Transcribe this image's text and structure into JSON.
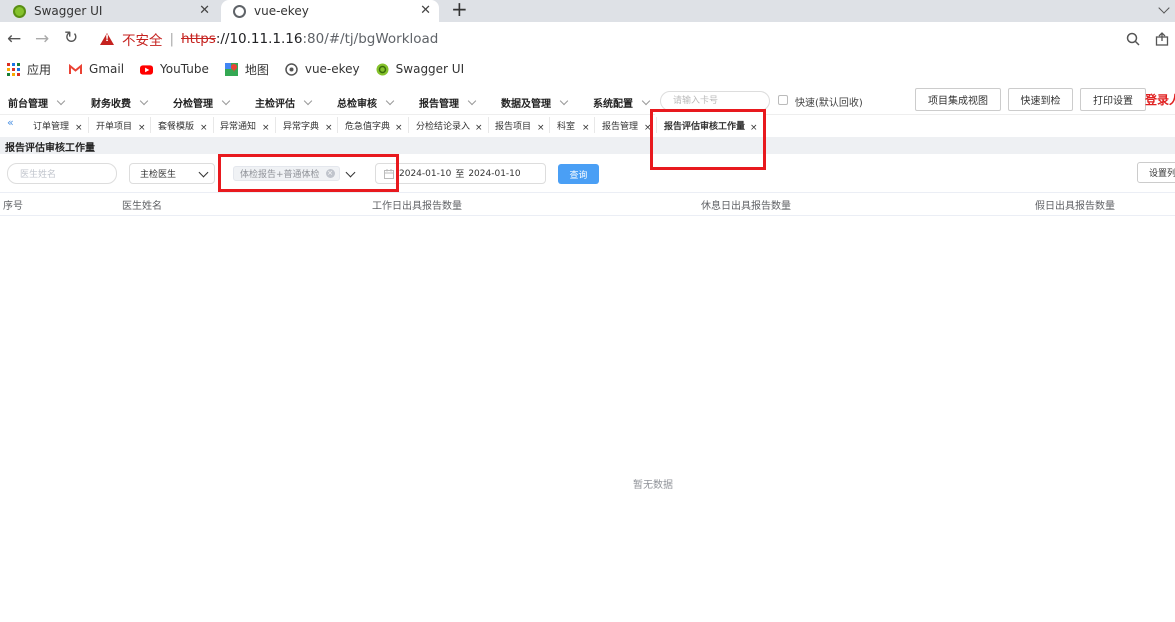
{
  "browser": {
    "tabs": [
      {
        "title": "Swagger UI",
        "close": "✕"
      },
      {
        "title": "vue-ekey",
        "close": "✕"
      }
    ],
    "new_tab": "+",
    "security_label": "不安全",
    "separator": "|",
    "url_protocol": "https",
    "url_host": "://10.11.1.16",
    "url_path": ":80/#/tj/bgWorkload",
    "bookmarks": [
      {
        "label": "应用",
        "icon": "apps-grid-icon"
      },
      {
        "label": "Gmail",
        "icon": "gmail-icon"
      },
      {
        "label": "YouTube",
        "icon": "youtube-icon"
      },
      {
        "label": "地图",
        "icon": "maps-icon"
      },
      {
        "label": "vue-ekey",
        "icon": "globe-icon"
      },
      {
        "label": "Swagger UI",
        "icon": "swagger-icon"
      }
    ]
  },
  "app": {
    "menus": [
      "前台管理",
      "财务收费",
      "分检管理",
      "主检评估",
      "总检审核",
      "报告管理",
      "数据及管理",
      "系统配置"
    ],
    "card_placeholder": "请输入卡号",
    "fast_check_label": "快速(默认回收)",
    "buttons": {
      "project_view": "项目集成视图",
      "quick_checkin": "快速到检",
      "print_settings": "打印设置"
    },
    "login_label": "登录人",
    "collapse_icon": "«",
    "page_tabs": [
      "订单管理",
      "开单项目",
      "套餐模版",
      "异常通知",
      "异常字典",
      "危急值字典",
      "分检结论录入",
      "报告项目",
      "科室",
      "报告管理",
      "报告评估审核工作量"
    ],
    "tab_close": "×",
    "page_title": "报告评估审核工作量"
  },
  "filters": {
    "doctor_name_placeholder": "医生姓名",
    "doctor_role": "主检医生",
    "report_type_tag": "体检报告+普通体检",
    "tag_close": "×",
    "date_start": "2024-01-10",
    "date_sep": "至",
    "date_end": "2024-01-10",
    "query_label": "查询",
    "set_columns_label": "设置列"
  },
  "table": {
    "columns": [
      "序号",
      "医生姓名",
      "工作日出具报告数量",
      "休息日出具报告数量",
      "假日出具报告数量"
    ],
    "empty_text": "暂无数据"
  }
}
